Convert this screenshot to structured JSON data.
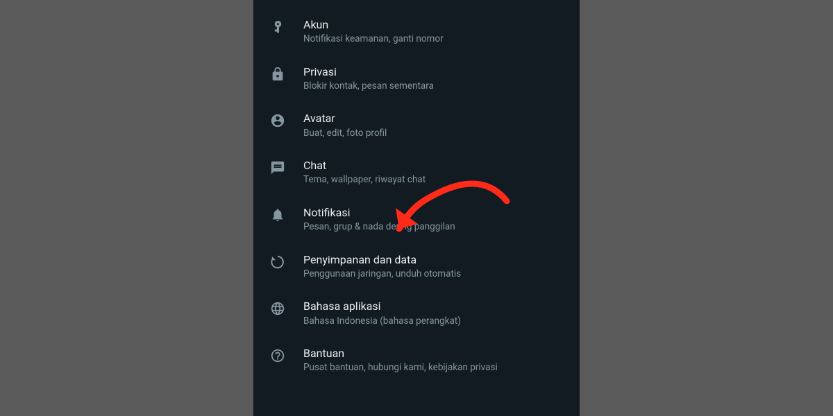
{
  "settings": [
    {
      "title": "Akun",
      "subtitle": "Notifikasi keamanan, ganti nomor",
      "icon": "key"
    },
    {
      "title": "Privasi",
      "subtitle": "Blokir kontak, pesan sementara",
      "icon": "lock"
    },
    {
      "title": "Avatar",
      "subtitle": "Buat, edit, foto profil",
      "icon": "avatar"
    },
    {
      "title": "Chat",
      "subtitle": "Tema, wallpaper, riwayat chat",
      "icon": "chat"
    },
    {
      "title": "Notifikasi",
      "subtitle": "Pesan, grup & nada dering panggilan",
      "icon": "bell"
    },
    {
      "title": "Penyimpanan dan data",
      "subtitle": "Penggunaan jaringan, unduh otomatis",
      "icon": "data"
    },
    {
      "title": "Bahasa aplikasi",
      "subtitle": "Bahasa Indonesia (bahasa perangkat)",
      "icon": "globe"
    },
    {
      "title": "Bantuan",
      "subtitle": "Pusat bantuan, hubungi kami, kebijakan privasi",
      "icon": "help"
    }
  ]
}
